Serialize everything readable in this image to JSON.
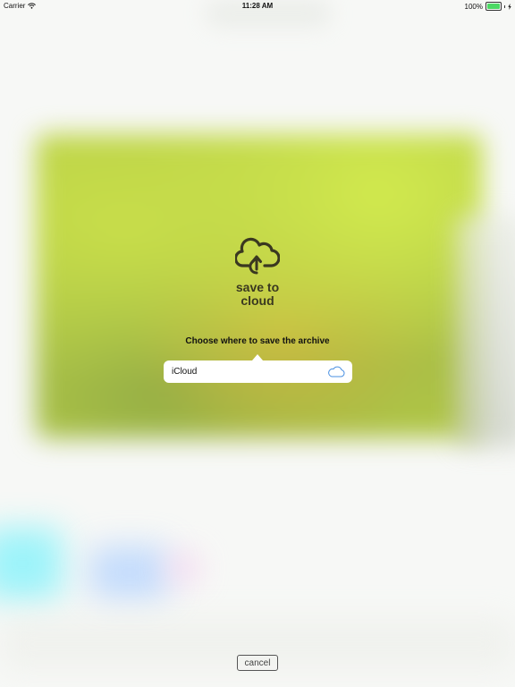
{
  "status_bar": {
    "carrier": "Carrier",
    "time": "11:28 AM",
    "battery_percent": "100%",
    "battery_level": 1.0
  },
  "logo": {
    "title_line1": "save to",
    "title_line2": "cloud",
    "icon": "cloud-upload-icon"
  },
  "dialog": {
    "prompt": "Choose where to save the archive",
    "options": [
      {
        "label": "iCloud",
        "icon": "cloud-icon"
      }
    ]
  },
  "cancel_label": "cancel",
  "colors": {
    "accent": "#4a90e2",
    "battery": "#4cd964",
    "logo": "#3a3820"
  }
}
